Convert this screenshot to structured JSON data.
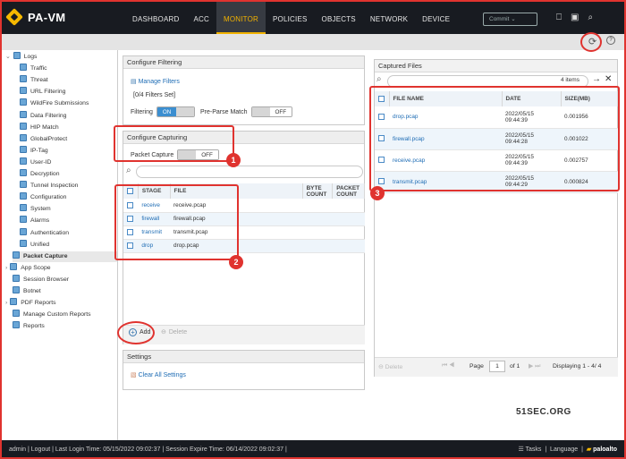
{
  "app": {
    "logo_text": "PA-VM"
  },
  "nav": {
    "tabs": [
      "DASHBOARD",
      "ACC",
      "MONITOR",
      "POLICIES",
      "OBJECTS",
      "NETWORK",
      "DEVICE"
    ],
    "active": "MONITOR",
    "commit_label": "Commit ⌄"
  },
  "sidebar": {
    "items": [
      {
        "label": "Logs",
        "indent": 0,
        "expander": "⌄"
      },
      {
        "label": "Traffic",
        "indent": 2
      },
      {
        "label": "Threat",
        "indent": 2
      },
      {
        "label": "URL Filtering",
        "indent": 2
      },
      {
        "label": "WildFire Submissions",
        "indent": 2
      },
      {
        "label": "Data Filtering",
        "indent": 2
      },
      {
        "label": "HIP Match",
        "indent": 2
      },
      {
        "label": "GlobalProtect",
        "indent": 2
      },
      {
        "label": "IP-Tag",
        "indent": 2
      },
      {
        "label": "User-ID",
        "indent": 2
      },
      {
        "label": "Decryption",
        "indent": 2
      },
      {
        "label": "Tunnel Inspection",
        "indent": 2
      },
      {
        "label": "Configuration",
        "indent": 2
      },
      {
        "label": "System",
        "indent": 2
      },
      {
        "label": "Alarms",
        "indent": 2
      },
      {
        "label": "Authentication",
        "indent": 2
      },
      {
        "label": "Unified",
        "indent": 2
      },
      {
        "label": "Packet Capture",
        "indent": 1,
        "selected": true
      },
      {
        "label": "App Scope",
        "indent": 0,
        "expander": "›"
      },
      {
        "label": "Session Browser",
        "indent": 1
      },
      {
        "label": "Botnet",
        "indent": 1
      },
      {
        "label": "PDF Reports",
        "indent": 0,
        "expander": "›"
      },
      {
        "label": "Manage Custom Reports",
        "indent": 1
      },
      {
        "label": "Reports",
        "indent": 1
      }
    ]
  },
  "filtering": {
    "title": "Configure Filtering",
    "manage_link": "Manage Filters",
    "filters_set": "[0/4 Filters Set]",
    "filtering_label": "Filtering",
    "filtering_value": "ON",
    "preparse_label": "Pre-Parse Match",
    "preparse_value": "OFF"
  },
  "capturing": {
    "title": "Configure Capturing",
    "packet_capture_label": "Packet Capture",
    "packet_capture_value": "OFF",
    "columns": {
      "stage": "STAGE",
      "file": "FILE",
      "byte": "BYTE COUNT",
      "packet": "PACKET COUNT"
    },
    "rows": [
      {
        "stage": "receive",
        "file": "receive.pcap"
      },
      {
        "stage": "firewall",
        "file": "firewall.pcap"
      },
      {
        "stage": "transmit",
        "file": "transmit.pcap"
      },
      {
        "stage": "drop",
        "file": "drop.pcap"
      }
    ],
    "add_label": "Add",
    "delete_label": "Delete"
  },
  "settings": {
    "title": "Settings",
    "clear_label": "Clear All Settings"
  },
  "captured": {
    "title": "Captured Files",
    "count": "4 items",
    "columns": {
      "name": "FILE NAME",
      "date": "DATE",
      "size": "SIZE(MB)"
    },
    "rows": [
      {
        "name": "drop.pcap",
        "date": "2022/05/15 09:44:39",
        "size": "0.001956"
      },
      {
        "name": "firewall.pcap",
        "date": "2022/05/15 09:44:28",
        "size": "0.001022"
      },
      {
        "name": "receive.pcap",
        "date": "2022/05/15 09:44:39",
        "size": "0.002757"
      },
      {
        "name": "transmit.pcap",
        "date": "2022/05/15 09:44:29",
        "size": "0.000824"
      }
    ],
    "delete_label": "Delete",
    "page_label": "Page",
    "page_value": "1",
    "of_label": "of 1",
    "displaying": "Displaying 1 - 4/ 4"
  },
  "badges": [
    "1",
    "2",
    "3"
  ],
  "footer": {
    "text": "admin  |  Logout  |  Last Login Time: 05/15/2022 09:02:37  |  Session Expire Time: 06/14/2022 09:02:37  |",
    "tasks": "Tasks",
    "language": "Language",
    "brand": "paloalto"
  },
  "watermark": "51SEC.ORG"
}
